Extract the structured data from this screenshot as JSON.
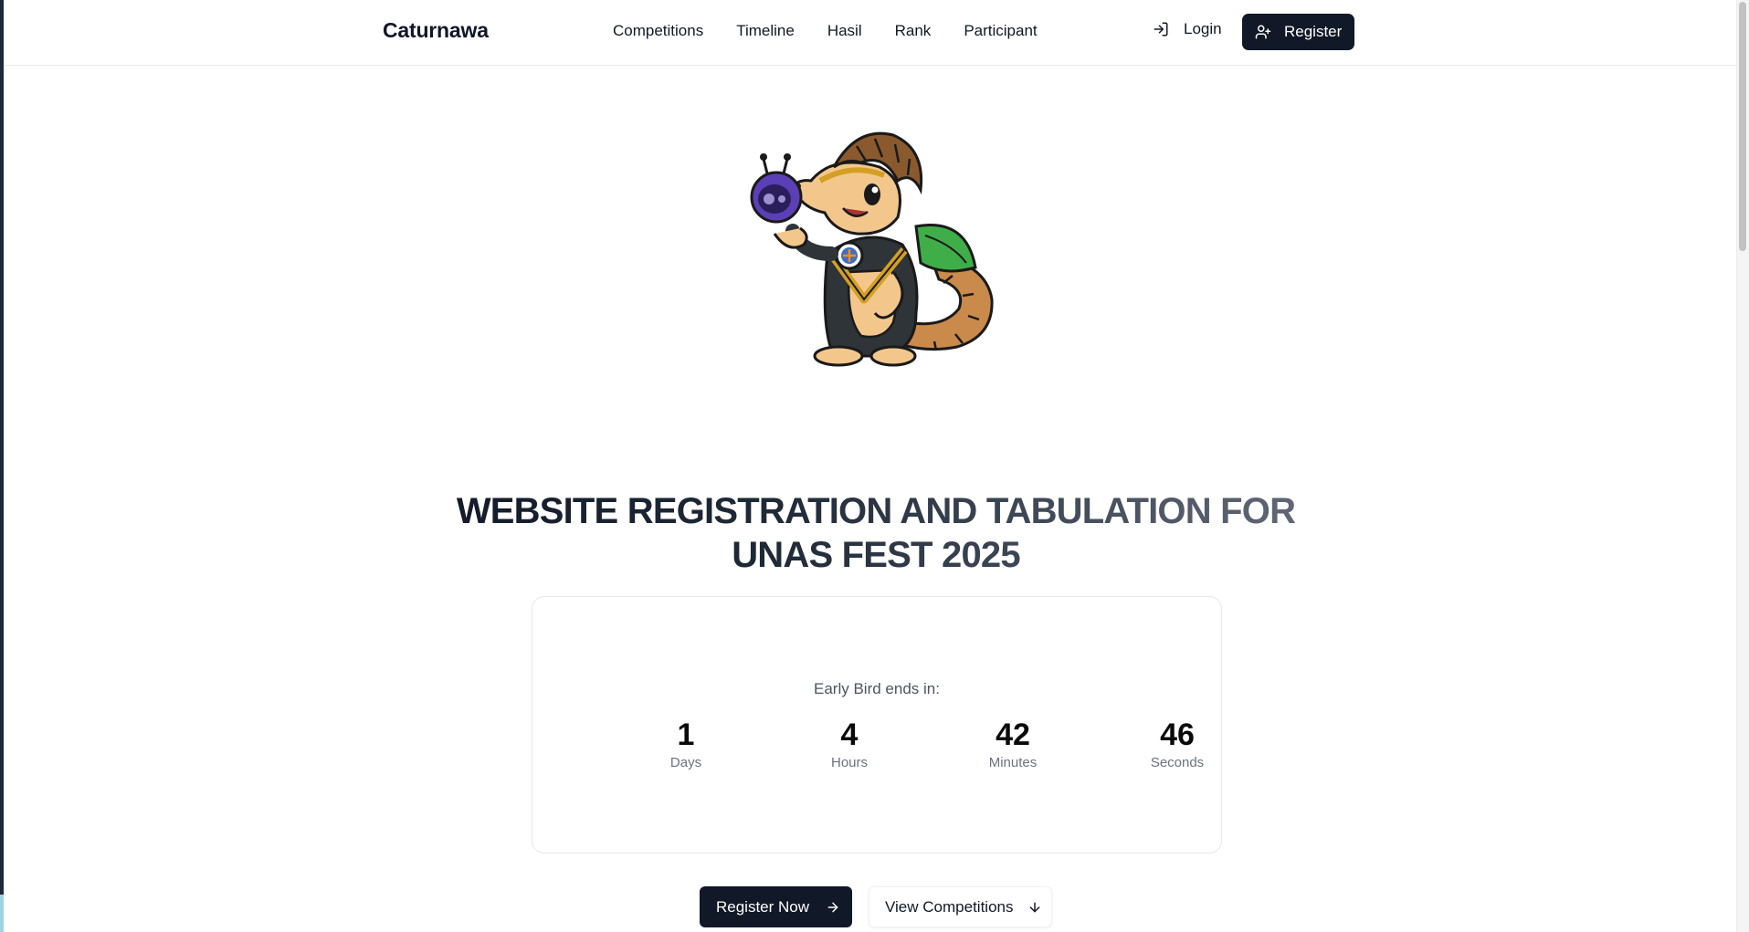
{
  "header": {
    "brand": "Caturnawa",
    "nav": [
      "Competitions",
      "Timeline",
      "Hasil",
      "Rank",
      "Participant"
    ],
    "login_label": "Login",
    "register_label": "Register"
  },
  "hero": {
    "headline_line1": "WEBSITE REGISTRATION AND TABULATION FOR",
    "headline_line2": "UNAS FEST 2025"
  },
  "countdown": {
    "label": "Early Bird ends in:",
    "units": [
      {
        "value": "1",
        "label": "Days"
      },
      {
        "value": "4",
        "label": "Hours"
      },
      {
        "value": "42",
        "label": "Minutes"
      },
      {
        "value": "46",
        "label": "Seconds"
      }
    ]
  },
  "cta": {
    "primary": "Register Now",
    "secondary": "View Competitions"
  },
  "icons": {
    "login": "login-icon",
    "register": "user-plus-icon",
    "arrow_right": "arrow-right-icon",
    "arrow_down": "arrow-down-icon"
  },
  "colors": {
    "primary": "#111827",
    "border": "#e5e7eb",
    "muted": "#6b7280"
  }
}
